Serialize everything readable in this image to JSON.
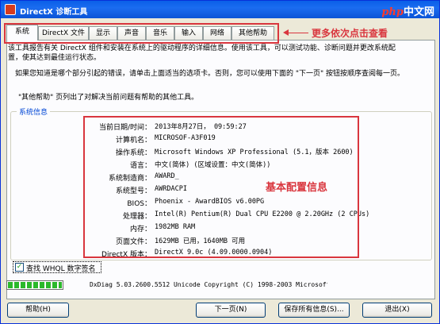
{
  "window": {
    "title": "DirectX 诊断工具",
    "logo_php": "php",
    "logo_cn": "中文网"
  },
  "tabs": [
    {
      "label": "系统",
      "active": true
    },
    {
      "label": "DirectX 文件"
    },
    {
      "label": "显示"
    },
    {
      "label": "声音"
    },
    {
      "label": "音乐"
    },
    {
      "label": "输入"
    },
    {
      "label": "网络"
    },
    {
      "label": "其他帮助"
    }
  ],
  "annotations": {
    "tabs_hint": "更多依次点击查看",
    "config_hint": "基本配置信息"
  },
  "intro": {
    "line1": "该工具报告有关 DirectX 组件和安装在系统上的驱动程序的详细信息。使用该工具，可以测试功能、诊断问题并更改系统配",
    "line2": "置，使其达到最佳运行状态。",
    "line3": "如果您知道是哪个部分引起的错误，请单击上面适当的选项卡。否则，您可以使用下面的 \"下一页\" 按钮按顺序查阅每一页。",
    "line4": "\"其他帮助\" 页列出了对解决当前问题有帮助的其他工具。"
  },
  "system_info": {
    "group_title": "系统信息",
    "rows": [
      {
        "label": "当前日期/时间：",
        "value": "2013年8月27日， 09:59:27"
      },
      {
        "label": "计算机名：",
        "value": "MICROSOF-A3F019"
      },
      {
        "label": "操作系统：",
        "value": "Microsoft Windows XP Professional (5.1，版本 2600)"
      },
      {
        "label": "语言：",
        "value": "中文(简体) (区域设置：中文(简体))"
      },
      {
        "label": "系统制造商：",
        "value": "AWARD_"
      },
      {
        "label": "系统型号：",
        "value": "AWRDACPI"
      },
      {
        "label": "BIOS：",
        "value": "Phoenix - AwardBIOS v6.00PG"
      },
      {
        "label": "处理器：",
        "value": "Intel(R) Pentium(R) Dual  CPU  E2200  @ 2.20GHz (2 CPUs)"
      },
      {
        "label": "内存：",
        "value": "1982MB RAM"
      },
      {
        "label": "页面文件：",
        "value": "1629MB 已用，1640MB 可用"
      },
      {
        "label": "DirectX 版本：",
        "value": "DirectX 9.0c (4.09.0000.0904)"
      }
    ]
  },
  "checkbox": {
    "label": "查找 WHQL 数字签名",
    "checked": true,
    "mark": "✓"
  },
  "status": {
    "progress": 1.0,
    "copyright": "DxDiag 5.03.2600.5512 Unicode  Copyright (C) 1998-2003 Microsoft"
  },
  "buttons": {
    "help": "帮助(H)",
    "next": "下一页(N)",
    "save_all": "保存所有信息(S)...",
    "exit": "退出(X)"
  },
  "colors": {
    "annotation_red": "#d9363e",
    "titlebar_blue": "#0a5fe8",
    "logo_red": "#ff3a2a"
  }
}
